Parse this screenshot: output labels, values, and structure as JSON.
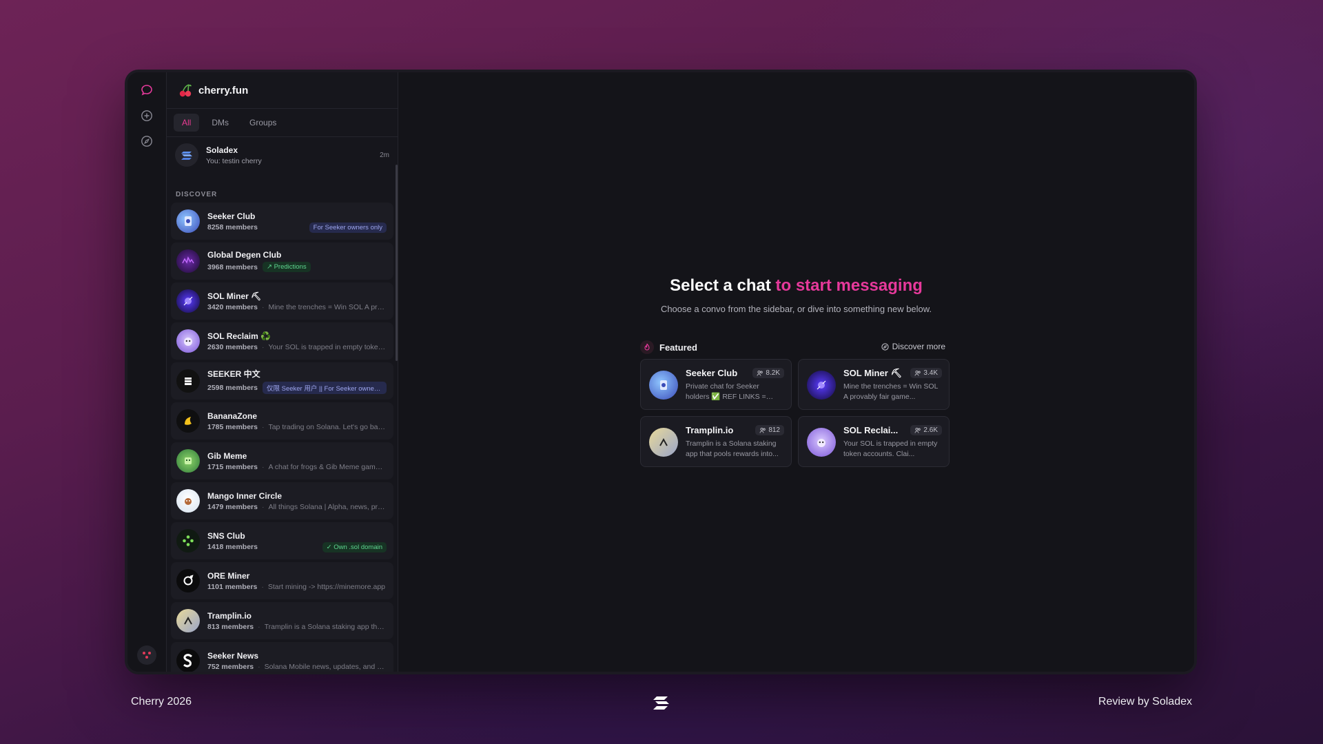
{
  "brand": {
    "name": "cherry.fun"
  },
  "tabs": [
    "All",
    "DMs",
    "Groups"
  ],
  "recent_dm": {
    "name": "Soladex",
    "preview": "You: testin cherry",
    "time": "2m"
  },
  "discover_label": "DISCOVER",
  "groups": [
    {
      "name": "Seeker Club",
      "members": "8258 members",
      "desc": "",
      "badge": "For Seeker owners only",
      "badge_style": "blue-right"
    },
    {
      "name": "Global Degen Club",
      "members": "3968 members",
      "desc": "",
      "badge": "↗ Predictions",
      "badge_style": "green-inline"
    },
    {
      "name": "SOL Miner ⛏",
      "members": "3420 members",
      "desc": "Mine the trenches = Win SOL A provably fair game",
      "badge": "",
      "badge_style": ""
    },
    {
      "name": "SOL Reclaim ♻️",
      "members": "2630 members",
      "desc": "Your SOL is trapped in empty token accounts",
      "badge": "",
      "badge_style": ""
    },
    {
      "name": "SEEKER 中文",
      "members": "2598 members",
      "desc": "",
      "badge": "仅限 Seeker 用户 || For Seeker owners only",
      "badge_style": "blue-inline"
    },
    {
      "name": "BananaZone",
      "members": "1785 members",
      "desc": "Tap trading on Solana. Let's go bananas",
      "badge": "",
      "badge_style": ""
    },
    {
      "name": "Gib Meme",
      "members": "1715 members",
      "desc": "A chat for frogs & Gib Meme game players",
      "badge": "",
      "badge_style": ""
    },
    {
      "name": "Mango Inner Circle",
      "members": "1479 members",
      "desc": "All things Solana | Alpha, news, products",
      "badge": "",
      "badge_style": ""
    },
    {
      "name": "SNS Club",
      "members": "1418 members",
      "desc": "",
      "badge": "✓ Own .sol domain",
      "badge_style": "green-right"
    },
    {
      "name": "ORE Miner",
      "members": "1101 members",
      "desc": "Start mining -> https://minemore.app",
      "badge": "",
      "badge_style": ""
    },
    {
      "name": "Tramplin.io",
      "members": "813 members",
      "desc": "Tramplin is a Solana staking app that pools rewards",
      "badge": "",
      "badge_style": ""
    },
    {
      "name": "Seeker News",
      "members": "752 members",
      "desc": "Solana Mobile news, updates, and more",
      "badge": "",
      "badge_style": ""
    }
  ],
  "main": {
    "headline_a": "Select a chat",
    "headline_b": "to start messaging",
    "subline": "Choose a convo from the sidebar, or dive into something new below.",
    "featured_label": "Featured",
    "discover_more": "Discover more",
    "featured": [
      {
        "name": "Seeker Club",
        "count": "8.2K",
        "desc": "Private chat for Seeker holders ✅ REF LINKS = BA..."
      },
      {
        "name": "SOL Miner ⛏",
        "count": "3.4K",
        "desc": "Mine the trenches = Win SOL A provably fair game..."
      },
      {
        "name": "Tramplin.io",
        "count": "812",
        "desc": "Tramplin is a Solana staking app that pools rewards into..."
      },
      {
        "name": "SOL Reclai...",
        "count": "2.6K",
        "desc": "Your SOL is trapped in empty token accounts. Clai..."
      }
    ]
  },
  "footer": {
    "left": "Cherry 2026",
    "right": "Review by Soladex"
  },
  "colors": {
    "accent": "#e6399b",
    "badge_blue": "#9ea6ee",
    "badge_green": "#5fd690"
  },
  "icons": [
    "chat-bubble-icon",
    "plus-circle-icon",
    "compass-icon",
    "cherry-logo-icon",
    "soladex-logo-icon",
    "users-icon",
    "flame-icon"
  ]
}
